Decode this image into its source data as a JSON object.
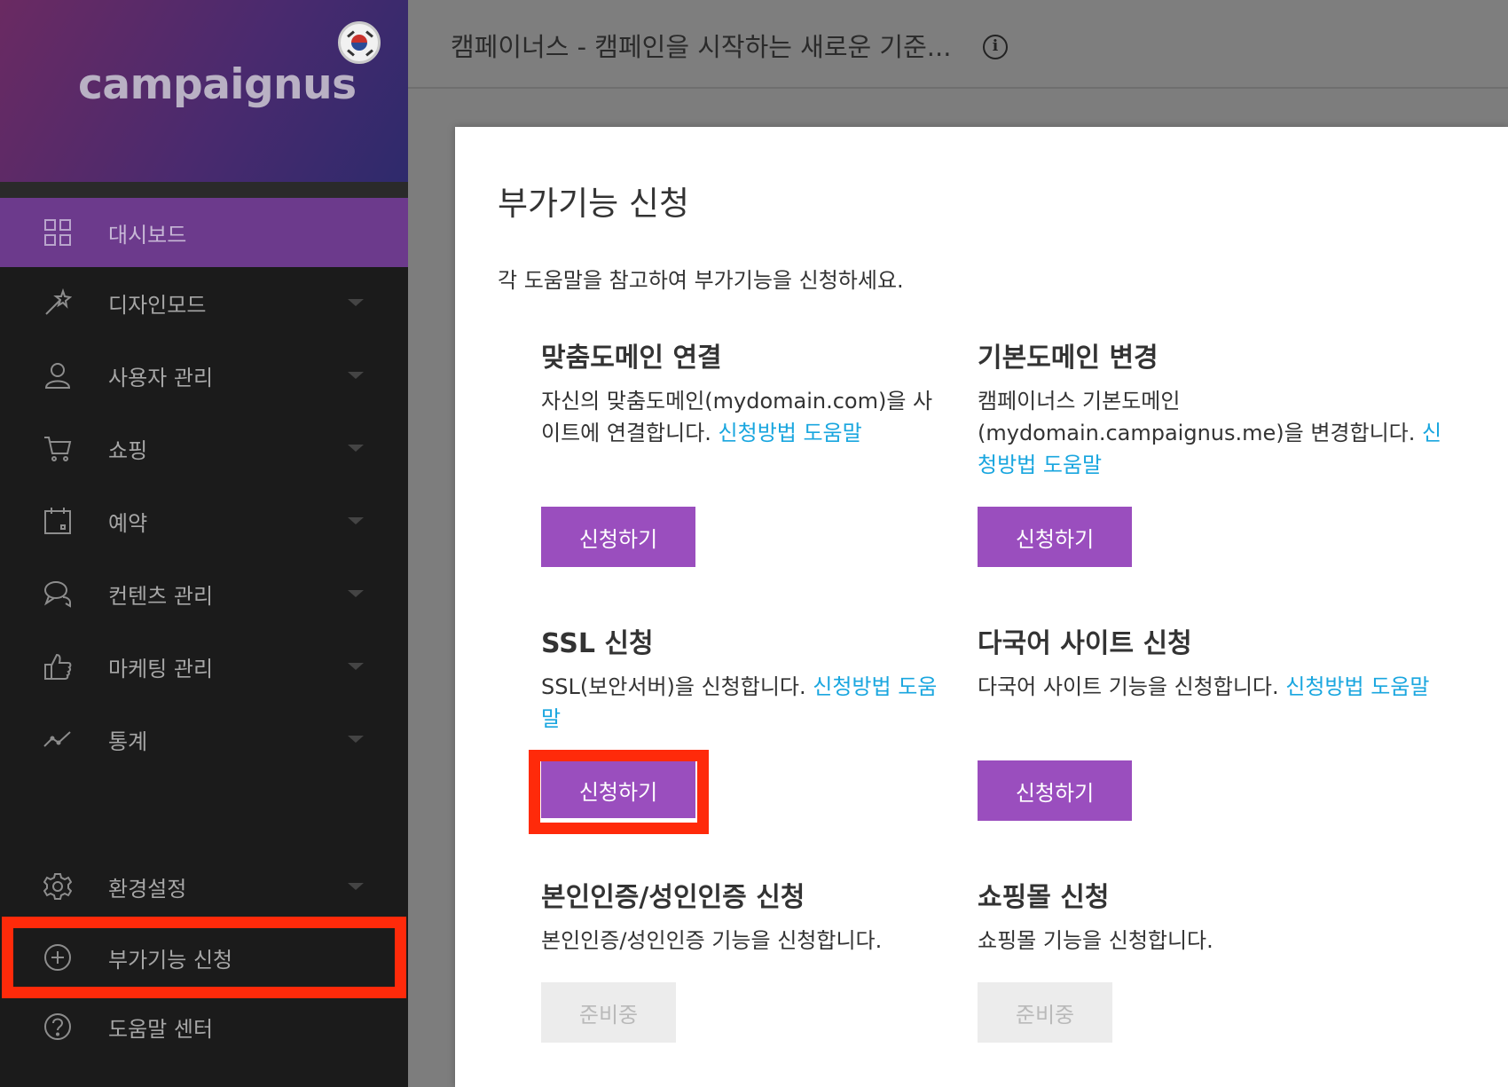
{
  "brand": {
    "logo": "campaignus",
    "flag_icon": "korea-flag-icon"
  },
  "header": {
    "title": "캠페이너스 - 캠페인을 시작하는 새로운 기준...",
    "info_icon": "info-icon"
  },
  "sidebar": {
    "items": [
      {
        "label": "대시보드",
        "icon": "grid-icon"
      },
      {
        "label": "디자인모드",
        "icon": "magic-wand-icon"
      },
      {
        "label": "사용자 관리",
        "icon": "user-icon"
      },
      {
        "label": "쇼핑",
        "icon": "cart-icon"
      },
      {
        "label": "예약",
        "icon": "calendar-icon"
      },
      {
        "label": "컨텐츠 관리",
        "icon": "chat-icon"
      },
      {
        "label": "마케팅 관리",
        "icon": "thumbs-up-icon"
      },
      {
        "label": "통계",
        "icon": "chart-line-icon"
      },
      {
        "label": "환경설정",
        "icon": "gear-icon"
      },
      {
        "label": "부가기능 신청",
        "icon": "plus-circle-icon"
      },
      {
        "label": "도움말 센터",
        "icon": "question-circle-icon"
      }
    ],
    "active_color": "#6c3a8c"
  },
  "modal": {
    "title": "부가기능 신청",
    "description": "각 도움말을 참고하여 부가기능을 신청하세요.",
    "cards": [
      {
        "title": "맞춤도메인 연결",
        "text": "자신의 맞춤도메인(mydomain.com)을 사이트에 연결합니다. ",
        "link": "신청방법 도움말",
        "button": "신청하기"
      },
      {
        "title": "기본도메인 변경",
        "text": "캠페이너스 기본도메인(mydomain.campaignus.me)을 변경합니다. ",
        "link": "신청방법 도움말",
        "button": "신청하기"
      },
      {
        "title": "SSL 신청",
        "text": "SSL(보안서버)을 신청합니다. ",
        "link": "신청방법 도움말",
        "button": "신청하기"
      },
      {
        "title": "다국어 사이트 신청",
        "text": "다국어 사이트 기능을 신청합니다. ",
        "link": "신청방법 도움말",
        "button": "신청하기"
      },
      {
        "title": "본인인증/성인인증 신청",
        "text": "본인인증/성인인증 기능을 신청합니다.",
        "button": "준비중"
      },
      {
        "title": "쇼핑몰 신청",
        "text": "쇼핑몰 기능을 신청합니다.",
        "button": "준비중"
      }
    ],
    "button_color": "#9a4ebe",
    "link_color": "#19a6df",
    "highlight_color": "#ff2a0a"
  }
}
